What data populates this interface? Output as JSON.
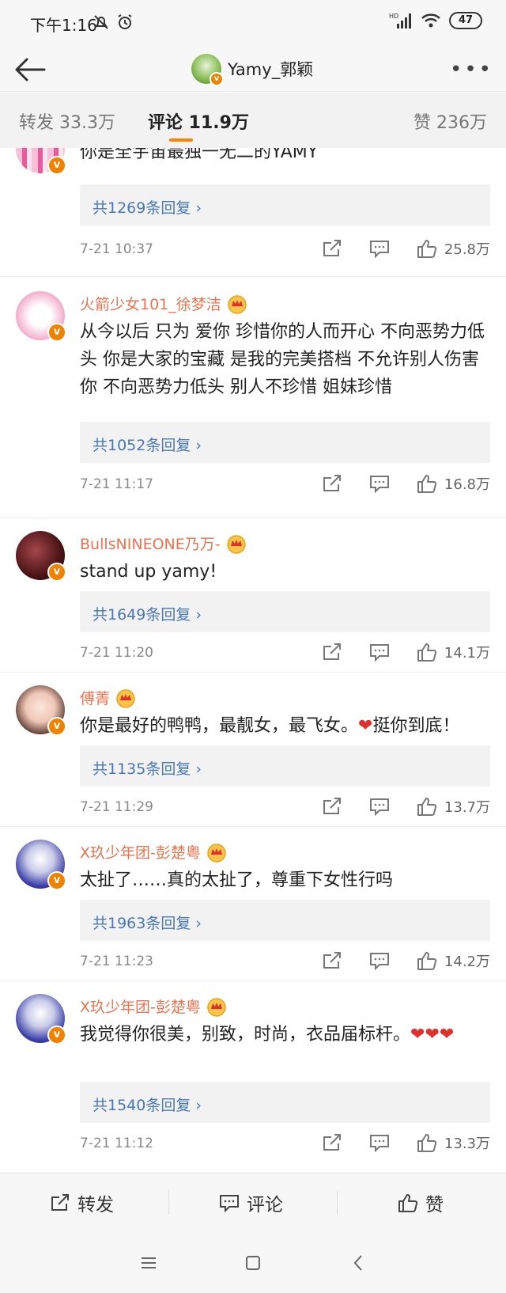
{
  "status_bar": {
    "time": "下午1:16",
    "hd": "HD",
    "battery": "47"
  },
  "nav": {
    "title": "Yamy_郭颖",
    "more": "•••"
  },
  "tabs": {
    "repost": "转发 33.3万",
    "comment": "评论 11.9万",
    "like": "赞 236万"
  },
  "comments": [
    {
      "name": "",
      "text": "你是全宇宙最独一无二的YAMY",
      "replies": "共1269条回复 ›",
      "time": "7-21 10:37",
      "likes": "25.8万"
    },
    {
      "name": "火箭少女101_徐梦洁",
      "text": "从今以后 只为 爱你 珍惜你的人而开心 不向恶势力低头 你是大家的宝藏 是我的完美搭档 不允许别人伤害你 不向恶势力低头 别人不珍惜 姐妹珍惜",
      "replies": "共1052条回复 ›",
      "time": "7-21 11:17",
      "likes": "16.8万"
    },
    {
      "name": "BullsNINEONE乃万-",
      "text": "stand up yamy!",
      "replies": "共1649条回复 ›",
      "time": "7-21 11:20",
      "likes": "14.1万"
    },
    {
      "name": "傅菁",
      "text": "你是最好的鸭鸭，最靓女，最飞女。",
      "text_tail": "挺你到底！",
      "heart": "❤",
      "replies": "共1135条回复 ›",
      "time": "7-21 11:29",
      "likes": "13.7万"
    },
    {
      "name": "X玖少年团-彭楚粤",
      "text": "太扯了……真的太扯了，尊重下女性行吗",
      "replies": "共1963条回复 ›",
      "time": "7-21 11:23",
      "likes": "14.2万"
    },
    {
      "name": "X玖少年团-彭楚粤",
      "text": "我觉得你很美，别致，时尚，衣品届标杆。",
      "hearts": "❤❤❤",
      "replies": "共1540条回复 ›",
      "time": "7-21 11:12",
      "likes": "13.3万"
    }
  ],
  "bottom_bar": {
    "repost": "转发",
    "comment": "评论",
    "like": "赞"
  },
  "colors": {
    "accent": "#ff8200",
    "username": "#eb7350",
    "link": "#4a78b4",
    "verified": "#f08200"
  }
}
